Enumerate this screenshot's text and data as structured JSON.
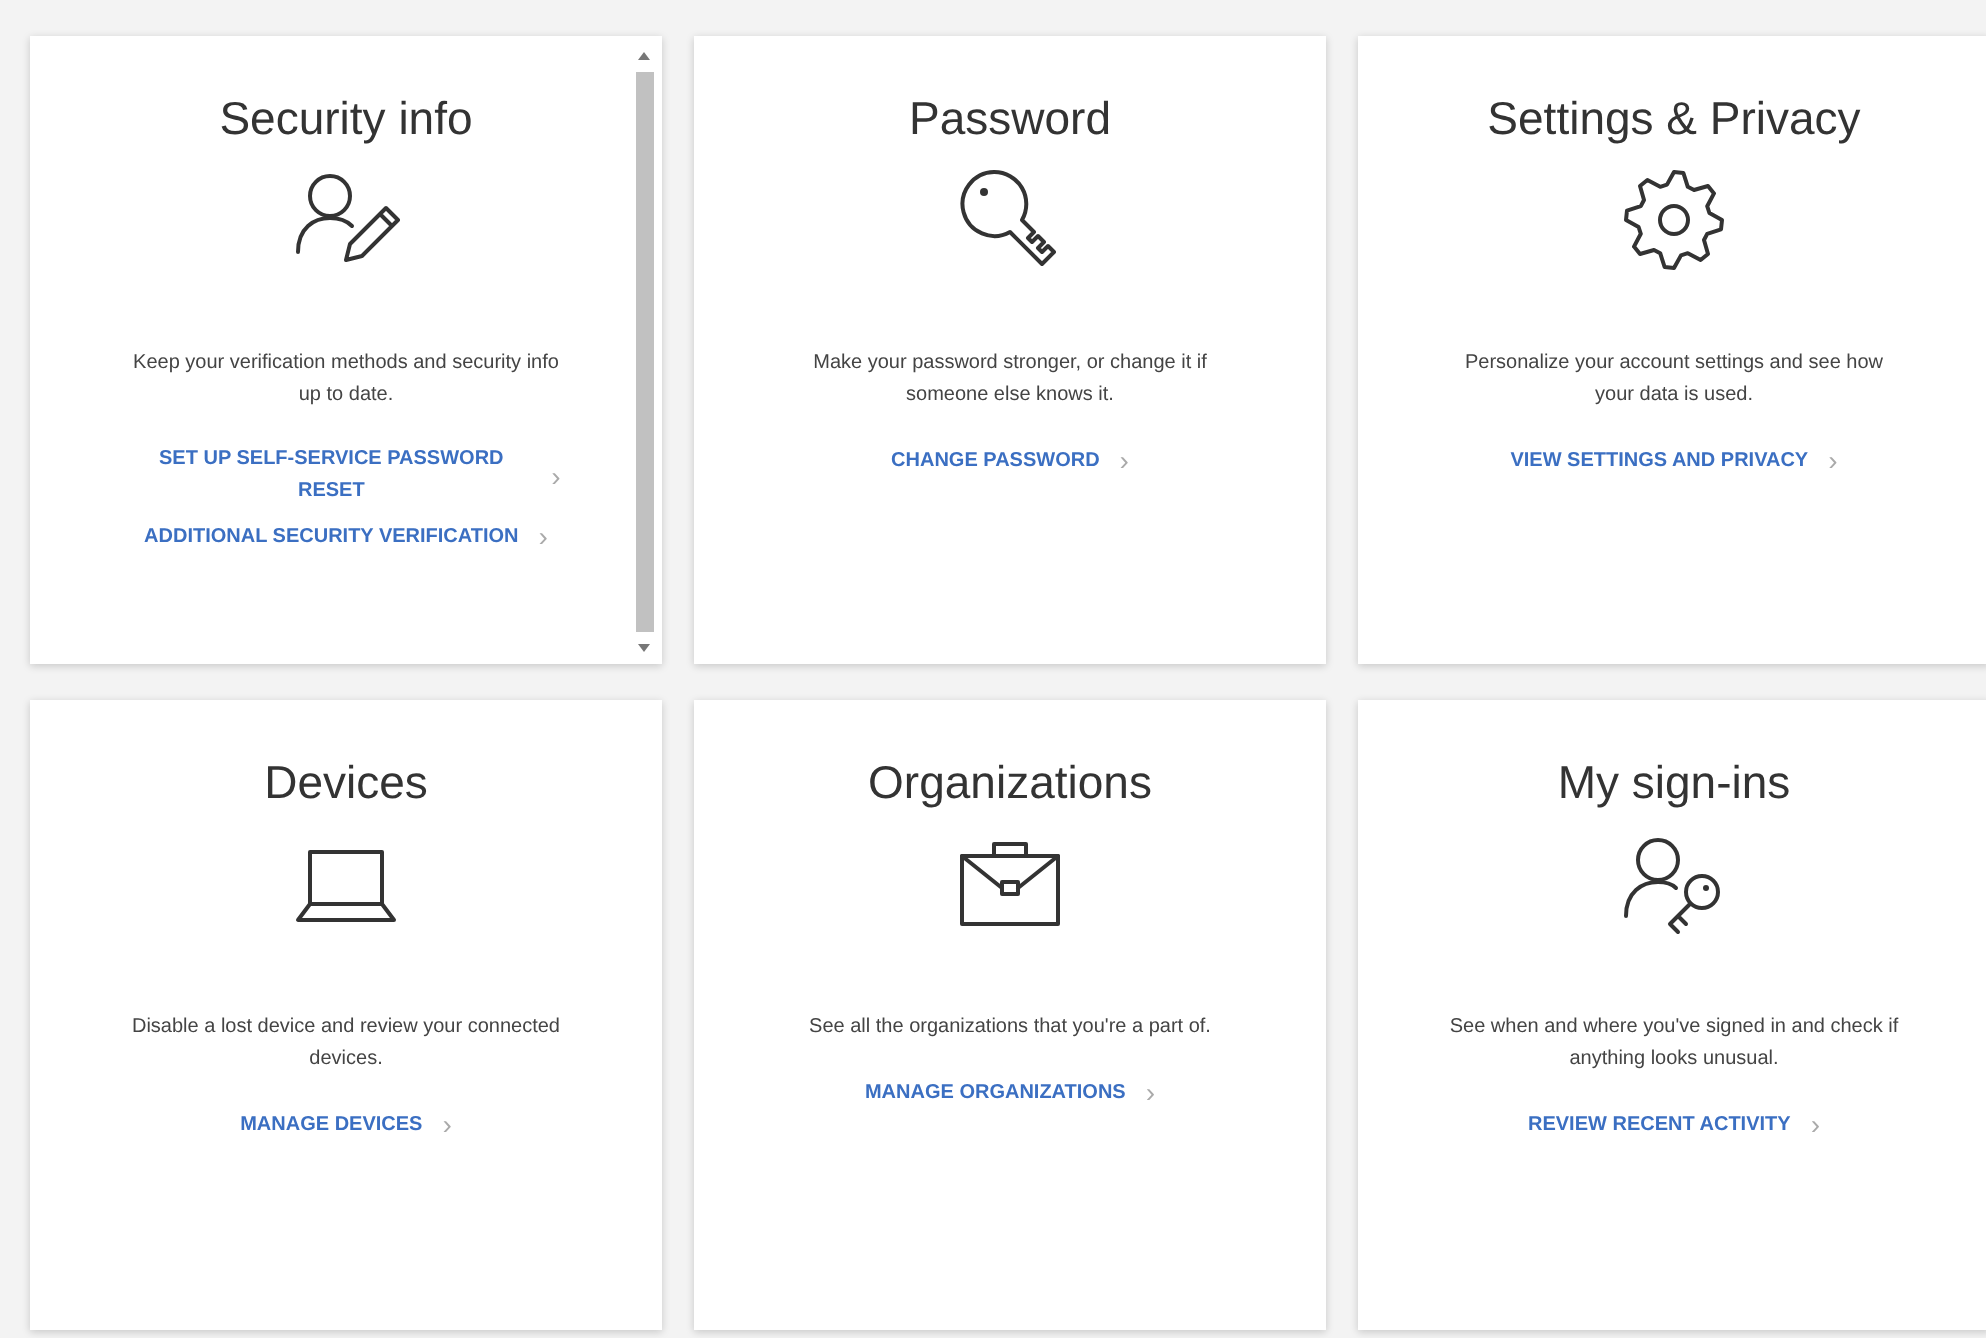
{
  "cards": [
    {
      "kind": "security",
      "title": "Security info",
      "description": "Keep your verification methods and security info up to date.",
      "scrollable": true,
      "links": [
        {
          "label": "SET UP SELF-SERVICE PASSWORD RESET",
          "chevron": "›"
        },
        {
          "label": "ADDITIONAL SECURITY VERIFICATION",
          "chevron": "›"
        }
      ]
    },
    {
      "kind": "password",
      "title": "Password",
      "description": "Make your password stronger, or change it if someone else knows it.",
      "scrollable": false,
      "links": [
        {
          "label": "CHANGE PASSWORD",
          "chevron": "›"
        }
      ]
    },
    {
      "kind": "settings",
      "title": "Settings & Privacy",
      "description": "Personalize your account settings and see how your data is used.",
      "scrollable": false,
      "links": [
        {
          "label": "VIEW SETTINGS AND PRIVACY",
          "chevron": "›"
        }
      ]
    },
    {
      "kind": "devices",
      "title": "Devices",
      "description": "Disable a lost device and review your connected devices.",
      "scrollable": false,
      "links": [
        {
          "label": "MANAGE DEVICES",
          "chevron": "›"
        }
      ]
    },
    {
      "kind": "organizations",
      "title": "Organizations",
      "description": "See all the organizations that you're a part of.",
      "scrollable": false,
      "links": [
        {
          "label": "MANAGE ORGANIZATIONS",
          "chevron": "›"
        }
      ]
    },
    {
      "kind": "signins",
      "title": "My sign-ins",
      "description": "See when and where you've signed in and check if anything looks unusual.",
      "scrollable": false,
      "links": [
        {
          "label": "REVIEW RECENT ACTIVITY",
          "chevron": "›"
        }
      ]
    }
  ]
}
